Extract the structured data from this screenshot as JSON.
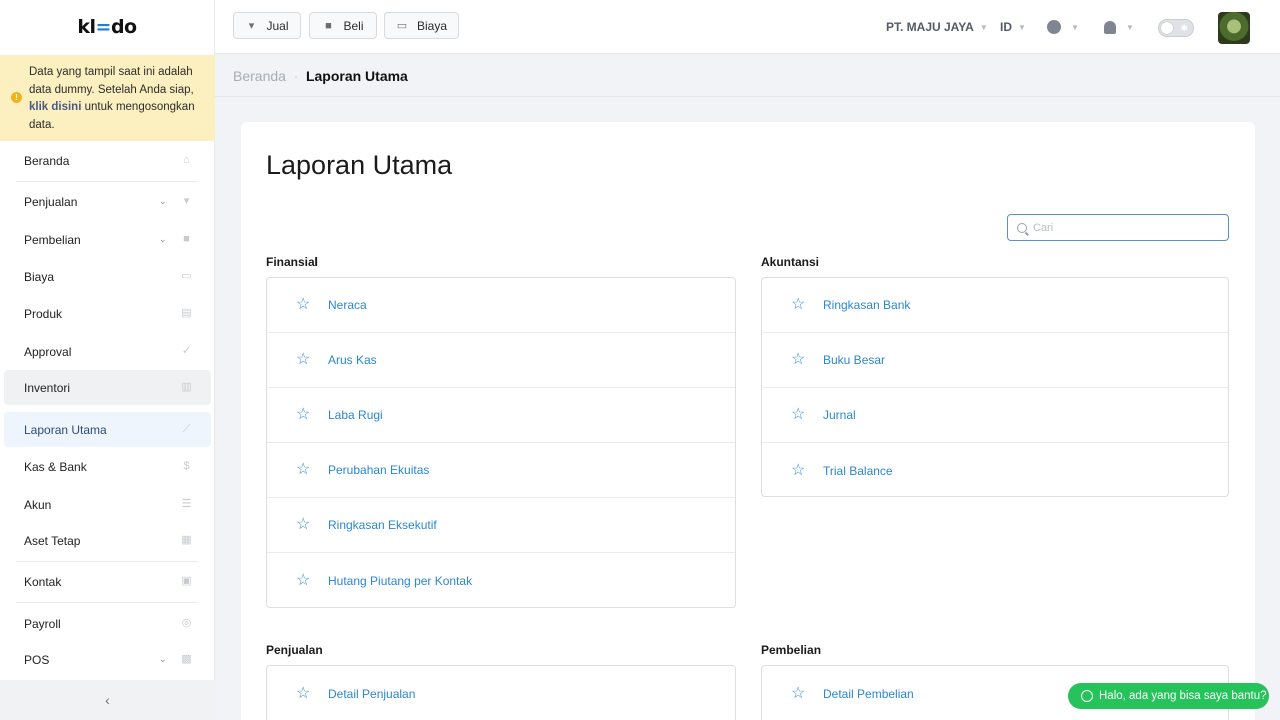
{
  "sidebar": {
    "logo": {
      "prefix": "kl",
      "mark": "=",
      "suffix": "do"
    },
    "notice": {
      "text_before": "Data yang tampil saat ini adalah data dummy. Setelah Anda siap, ",
      "link": "klik disini",
      "text_after": " untuk mengosongkan data."
    },
    "items": [
      {
        "label": "Beranda",
        "icon": "home-icon"
      },
      {
        "label": "Penjualan",
        "icon": "basket-icon",
        "expandable": true
      },
      {
        "label": "Pembelian",
        "icon": "bag-icon",
        "expandable": true
      },
      {
        "label": "Biaya",
        "icon": "card-icon"
      },
      {
        "label": "Produk",
        "icon": "box-icon"
      },
      {
        "label": "Approval",
        "icon": "check-icon"
      },
      {
        "label": "Inventori",
        "icon": "warehouse-icon"
      },
      {
        "label": "Laporan Utama",
        "icon": "chart-icon"
      },
      {
        "label": "Kas & Bank",
        "icon": "dollar-icon"
      },
      {
        "label": "Akun",
        "icon": "list-icon"
      },
      {
        "label": "Aset Tetap",
        "icon": "building-icon"
      },
      {
        "label": "Kontak",
        "icon": "contact-icon"
      },
      {
        "label": "Payroll",
        "icon": "payroll-icon"
      },
      {
        "label": "POS",
        "icon": "pos-icon",
        "expandable": true
      }
    ],
    "collapse_icon": "chevron-left-icon"
  },
  "topbar": {
    "buttons": [
      {
        "label": "Jual",
        "icon": "basket-icon"
      },
      {
        "label": "Beli",
        "icon": "bag-icon"
      },
      {
        "label": "Biaya",
        "icon": "card-icon"
      }
    ],
    "company": "PT. MAJU JAYA",
    "language": "ID",
    "clock_icon": "clock-icon",
    "bell_icon": "bell-icon",
    "theme_toggle_icon": "sun-icon"
  },
  "breadcrumb": {
    "home": "Beranda",
    "separator": "·",
    "current": "Laporan Utama"
  },
  "page": {
    "title": "Laporan Utama",
    "search_placeholder": "Cari",
    "sections": [
      {
        "title": "Finansial",
        "items": [
          "Neraca",
          "Arus Kas",
          "Laba Rugi",
          "Perubahan Ekuitas",
          "Ringkasan Eksekutif",
          "Hutang Piutang per Kontak"
        ]
      },
      {
        "title": "Akuntansi",
        "items": [
          "Ringkasan Bank",
          "Buku Besar",
          "Jurnal",
          "Trial Balance"
        ]
      },
      {
        "title": "Penjualan",
        "items": [
          "Detail Penjualan"
        ]
      },
      {
        "title": "Pembelian",
        "items": [
          "Detail Pembelian"
        ]
      }
    ]
  },
  "whatsapp": {
    "label": "Halo, ada yang bisa saya bantu?",
    "icon": "whatsapp-icon"
  },
  "colors": {
    "accent": "#2b87d0",
    "notice_bg": "#fdf0c0",
    "whatsapp": "#25c35a"
  }
}
